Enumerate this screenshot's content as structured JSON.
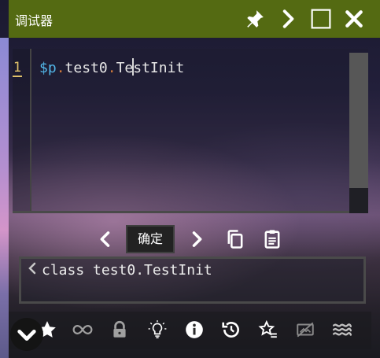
{
  "window": {
    "title": "调试器",
    "buttons": [
      "pin-icon",
      "chevron-right-icon",
      "maximize-icon",
      "close-icon"
    ]
  },
  "editor": {
    "line_number": "1",
    "code": {
      "var": "$p",
      "dot1": ".",
      "part2": "test0",
      "dot2": ".",
      "part3a": "Te",
      "part3b": "stInit"
    }
  },
  "controls": {
    "confirm_label": "确定",
    "icons": [
      "chevron-left-icon",
      "chevron-right-icon",
      "copy-icon",
      "clipboard-icon"
    ]
  },
  "result": {
    "text": "class test0.TestInit"
  },
  "bottom_toolbar": {
    "icons": [
      "star-icon",
      "infinity-icon",
      "lock-icon",
      "lightbulb-icon",
      "info-icon",
      "history-icon",
      "star-list-icon",
      "no-image-icon",
      "waves-icon"
    ],
    "fab_icon": "chevron-down-icon"
  },
  "colors": {
    "titlebar": "#546a12",
    "line_number": "#e0c16a",
    "variable": "#52b6e8",
    "operator_dot": "#d07a3c"
  }
}
